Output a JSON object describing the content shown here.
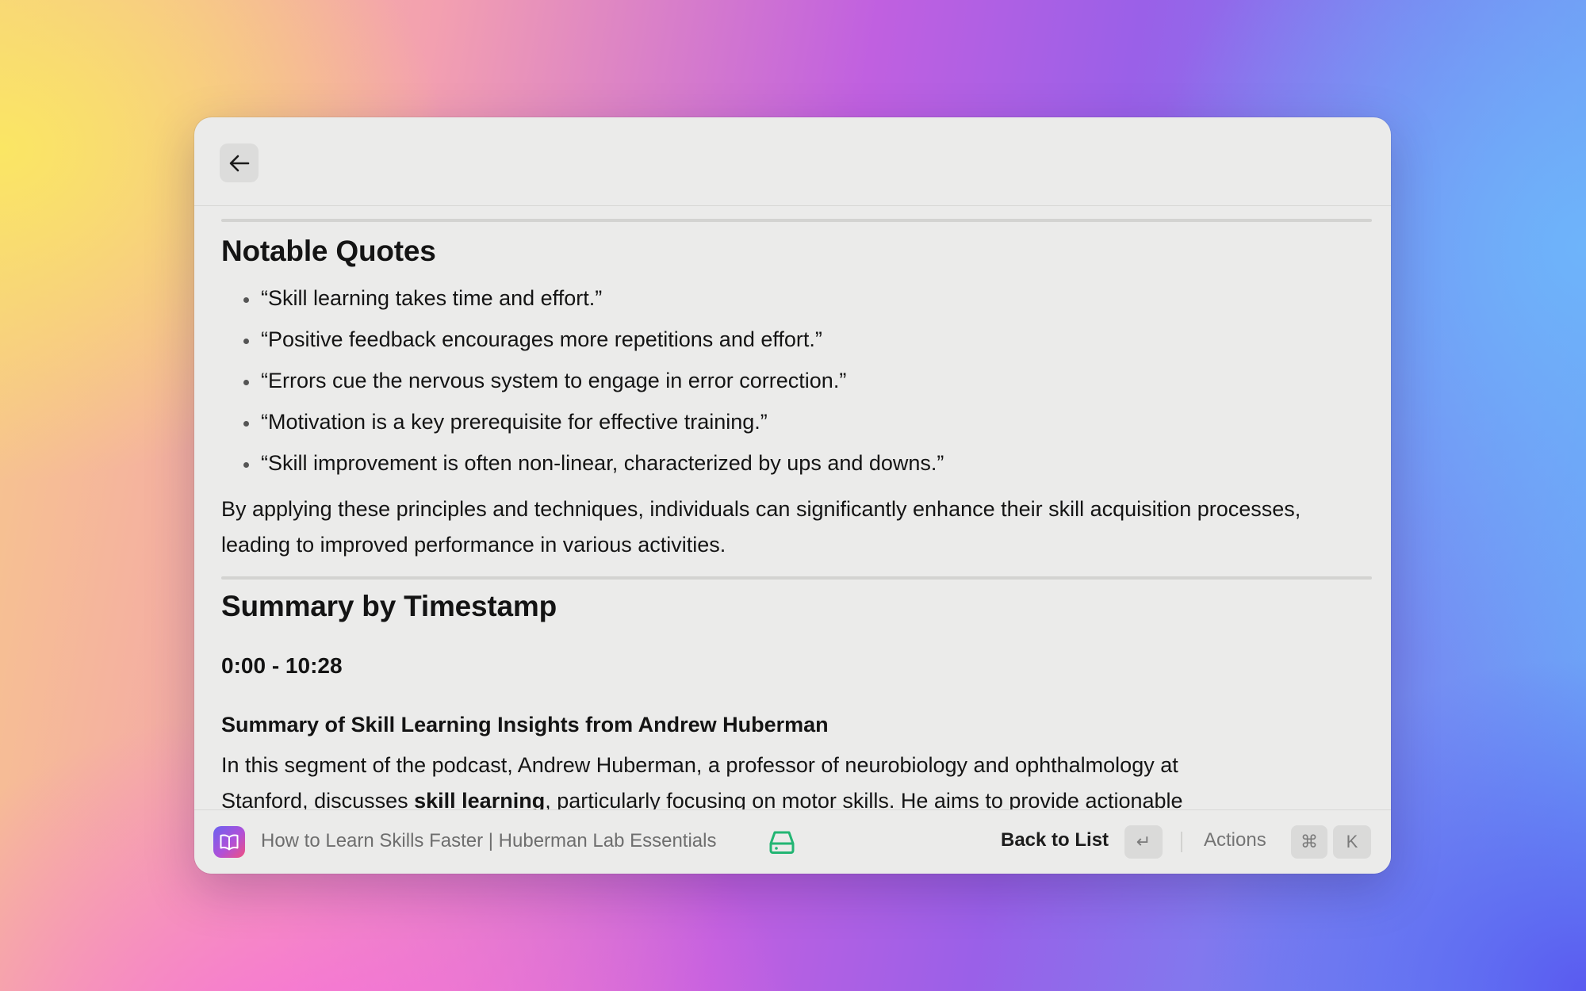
{
  "window": {
    "back_icon": "arrow-left-icon"
  },
  "content": {
    "quotes_heading": "Notable Quotes",
    "quotes": [
      "“Skill learning takes time and effort.”",
      "“Positive feedback encourages more repetitions and effort.”",
      "“Errors cue the nervous system to engage in error correction.”",
      "“Motivation is a key prerequisite for effective training.”",
      "“Skill improvement is often non-linear, characterized by ups and downs.”"
    ],
    "conclusion": "By applying these principles and techniques, individuals can significantly enhance their skill acquisition processes, leading to improved performance in various activities.",
    "summary_heading": "Summary by Timestamp",
    "timestamp": "0:00 - 10:28",
    "segment_title": "Summary of Skill Learning Insights from Andrew Huberman",
    "segment_text_1": "In this segment of the podcast, Andrew Huberman, a professor of neurobiology and ophthalmology at",
    "segment_text_2a": "Stanford, discusses ",
    "segment_text_2b": "skill learning",
    "segment_text_2c": ", particularly focusing on motor skills. He aims to provide actionable"
  },
  "footer": {
    "app_icon": "book-icon",
    "title": "How to Learn Skills Faster | Huberman Lab Essentials",
    "drive_icon": "drive-icon",
    "back_to_list": "Back to List",
    "enter_key": "↵",
    "actions": "Actions",
    "cmd_key": "⌘",
    "k_key": "K"
  },
  "colors": {
    "window_bg": "#ebebea",
    "accent_green": "#22b573",
    "text": "#141414"
  }
}
